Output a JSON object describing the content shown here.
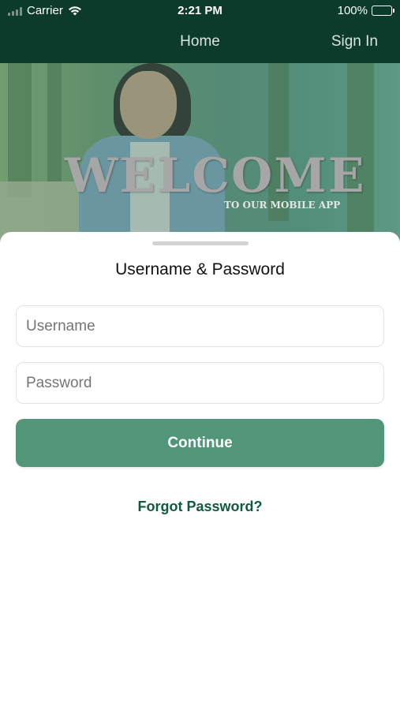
{
  "status_bar": {
    "carrier": "Carrier",
    "time": "2:21 PM",
    "battery_percent": "100%",
    "icons": [
      "signal-icon",
      "wifi-icon",
      "battery-icon"
    ]
  },
  "nav": {
    "title": "Home",
    "sign_in": "Sign In"
  },
  "hero": {
    "welcome": "WELCOME",
    "subtitle": "TO OUR MOBILE APP"
  },
  "login": {
    "title": "Username & Password",
    "username_placeholder": "Username",
    "password_placeholder": "Password",
    "continue_label": "Continue",
    "forgot_label": "Forgot Password?"
  },
  "colors": {
    "header_bg": "#0c3a2b",
    "primary_button": "#519679",
    "link": "#0d5c3c"
  }
}
